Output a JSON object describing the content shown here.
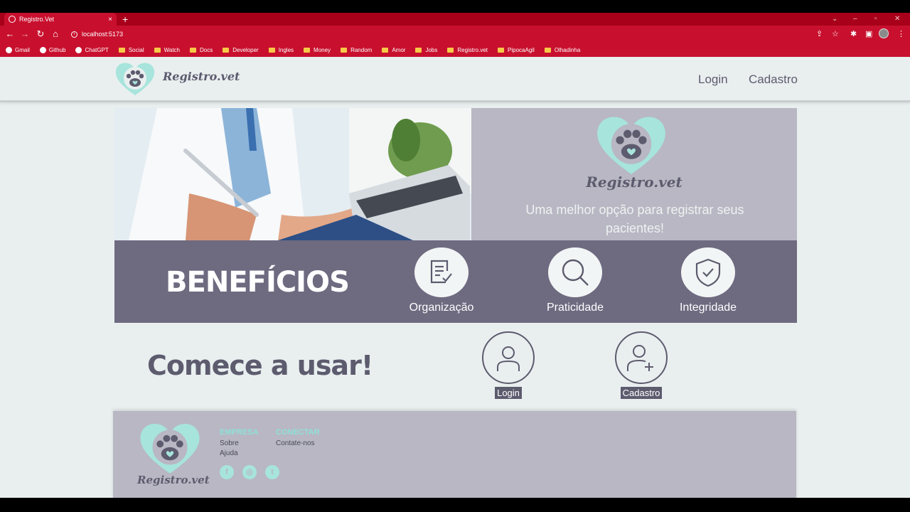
{
  "browser": {
    "tab_title": "Registro.Vet",
    "tab_close": "×",
    "new_tab": "+",
    "url": "localhost:5173",
    "bookmarks": [
      "Gmail",
      "Github",
      "ChatGPT",
      "Social",
      "Watch",
      "Docs",
      "Developer",
      "Ingles",
      "Money",
      "Random",
      "Amor",
      "Jobs",
      "Registro.vet",
      "PipocaAgil",
      "Olhadinha"
    ]
  },
  "nav": {
    "brand": "Registro.vet",
    "login": "Login",
    "cadastro": "Cadastro"
  },
  "hero": {
    "brand": "Registro.vet",
    "tagline": "Uma melhor opção para registrar seus pacientes!"
  },
  "benefits": {
    "title": "BENEFÍCIOS",
    "items": [
      {
        "label": "Organização",
        "icon": "checklist-icon"
      },
      {
        "label": "Praticidade",
        "icon": "magnifier-icon"
      },
      {
        "label": "Integridade",
        "icon": "shield-check-icon"
      }
    ]
  },
  "start": {
    "title": "Comece a usar!",
    "login": "Login",
    "cadastro": "Cadastro"
  },
  "footer": {
    "brand": "Registro.vet",
    "company_heading": "EMPRESA",
    "company_links": [
      "Sobre",
      "Ajuda"
    ],
    "connect_heading": "CONECTAR",
    "connect_links": [
      "Contate-nos"
    ],
    "social": [
      "facebook-icon",
      "instagram-icon",
      "twitter-icon"
    ]
  },
  "colors": {
    "browser_red": "#c8102e",
    "brand_gray": "#5d5b6e",
    "accent_teal": "#8fe0d8",
    "panel": "#b8b7c3",
    "benefits_bg": "#6e6a80"
  }
}
